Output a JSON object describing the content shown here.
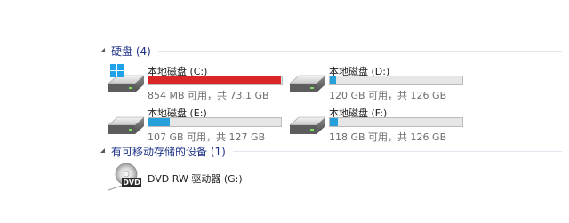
{
  "sections": {
    "hard_disks": {
      "title": "硬盘 (4)"
    },
    "removable": {
      "title": "有可移动存储的设备 (1)"
    }
  },
  "drives": [
    {
      "name": "本地磁盘 (C:)",
      "info": "854 MB 可用，共 73.1 GB",
      "used_fraction": 0.99,
      "bar_color": "#da2626",
      "windows_logo": true
    },
    {
      "name": "本地磁盘 (D:)",
      "info": "120 GB 可用，共 126 GB",
      "used_fraction": 0.05,
      "bar_color": "#26a0da",
      "windows_logo": false
    },
    {
      "name": "本地磁盘 (E:)",
      "info": "107 GB 可用，共 127 GB",
      "used_fraction": 0.16,
      "bar_color": "#26a0da",
      "windows_logo": false
    },
    {
      "name": "本地磁盘 (F:)",
      "info": "118 GB 可用，共 126 GB",
      "used_fraction": 0.06,
      "bar_color": "#26a0da",
      "windows_logo": false
    }
  ],
  "removable_devices": [
    {
      "name": "DVD RW 驱动器 (G:)",
      "icon_label": "DVD"
    }
  ],
  "colors": {
    "section_title": "#1e3287",
    "bar_ok": "#26a0da",
    "bar_full": "#da2626"
  }
}
